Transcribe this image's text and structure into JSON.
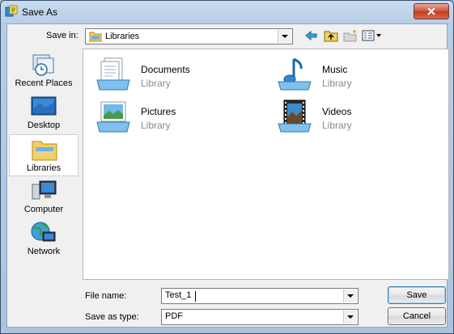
{
  "window": {
    "title": "Save As"
  },
  "toolbar": {
    "save_in_label": "Save in:",
    "save_in_value": "Libraries",
    "tools": [
      "back-arrow-icon",
      "up-folder-icon",
      "new-folder-icon",
      "views-menu-icon"
    ]
  },
  "places": [
    {
      "label": "Recent Places",
      "icon": "recent-places-icon",
      "selected": false
    },
    {
      "label": "Desktop",
      "icon": "desktop-icon",
      "selected": false
    },
    {
      "label": "Libraries",
      "icon": "libraries-icon",
      "selected": true
    },
    {
      "label": "Computer",
      "icon": "computer-icon",
      "selected": false
    },
    {
      "label": "Network",
      "icon": "network-icon",
      "selected": false
    }
  ],
  "files": [
    {
      "name": "Documents",
      "type": "Library",
      "icon": "documents-library-icon"
    },
    {
      "name": "Music",
      "type": "Library",
      "icon": "music-library-icon"
    },
    {
      "name": "Pictures",
      "type": "Library",
      "icon": "pictures-library-icon"
    },
    {
      "name": "Videos",
      "type": "Library",
      "icon": "videos-library-icon"
    }
  ],
  "form": {
    "file_name_label": "File name:",
    "file_name_value": "Test_1",
    "save_type_label": "Save as type:",
    "save_type_value": "PDF"
  },
  "buttons": {
    "save": "Save",
    "cancel": "Cancel"
  }
}
